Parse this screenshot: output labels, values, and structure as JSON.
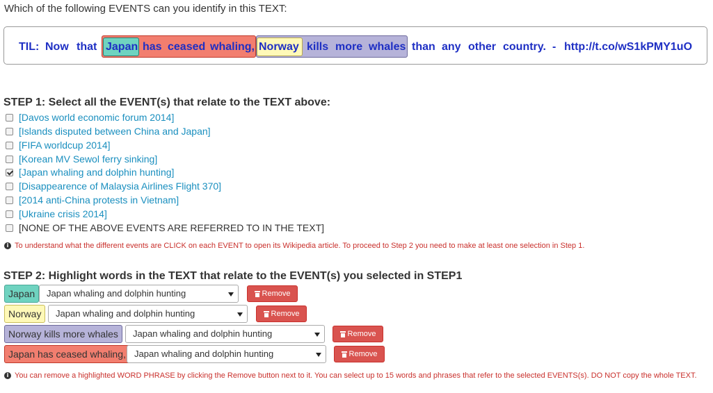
{
  "question": "Which of the following EVENTS can you identify in this TEXT:",
  "text_tokens": [
    "TIL:",
    "Now",
    "that",
    "Japan",
    "has",
    "ceased",
    "whaling,",
    "Norway",
    "kills",
    "more",
    "whales",
    "than",
    "any",
    "other",
    "country.",
    "-",
    "http://t.co/wS1kPMY1uO"
  ],
  "step1": {
    "title": "STEP 1: Select all the EVENT(s) that relate to the TEXT above:",
    "events": [
      {
        "label": "Davos world economic forum 2014",
        "checked": false
      },
      {
        "label": "Islands disputed between China and Japan",
        "checked": false
      },
      {
        "label": "FIFA worldcup 2014",
        "checked": false
      },
      {
        "label": "Korean MV Sewol ferry sinking",
        "checked": false
      },
      {
        "label": "Japan whaling and dolphin hunting",
        "checked": true
      },
      {
        "label": "Disappearence of Malaysia Airlines Flight 370",
        "checked": false
      },
      {
        "label": "2014 anti-China protests in Vietnam",
        "checked": false
      },
      {
        "label": "Ukraine crisis 2014",
        "checked": false
      },
      {
        "label": "NONE OF THE ABOVE EVENTS ARE REFERRED TO IN THE TEXT",
        "checked": false
      }
    ],
    "note": "To understand what the different events are CLICK on each EVENT to open its Wikipedia article. To proceed to Step 2 you need to make at least one selection in Step 1."
  },
  "step2": {
    "title": "STEP 2: Highlight words in the TEXT that relate to the EVENT(s) you selected in STEP1",
    "highlights": [
      {
        "phrase": "Japan",
        "event": "Japan whaling and dolphin hunting",
        "color": "#6fd3c0"
      },
      {
        "phrase": "Norway",
        "event": "Japan whaling and dolphin hunting",
        "color": "#fff9b8"
      },
      {
        "phrase": "Norway kills more whales",
        "event": "Japan whaling and dolphin hunting",
        "color": "#b6b3d9"
      },
      {
        "phrase": "Japan has ceased whaling,",
        "event": "Japan whaling and dolphin hunting",
        "color": "#f27e6f"
      }
    ],
    "remove_label": "Remove",
    "note": "You can remove a highlighted WORD PHRASE by clicking the Remove button next to it. You can select up to 15 words and phrases that refer to the selected EVENTS(s). DO NOT copy the whole TEXT."
  },
  "icons": {
    "info": "info-circle-icon",
    "trash": "trash-icon",
    "caret": "caret-down-icon",
    "check": "check-icon"
  }
}
